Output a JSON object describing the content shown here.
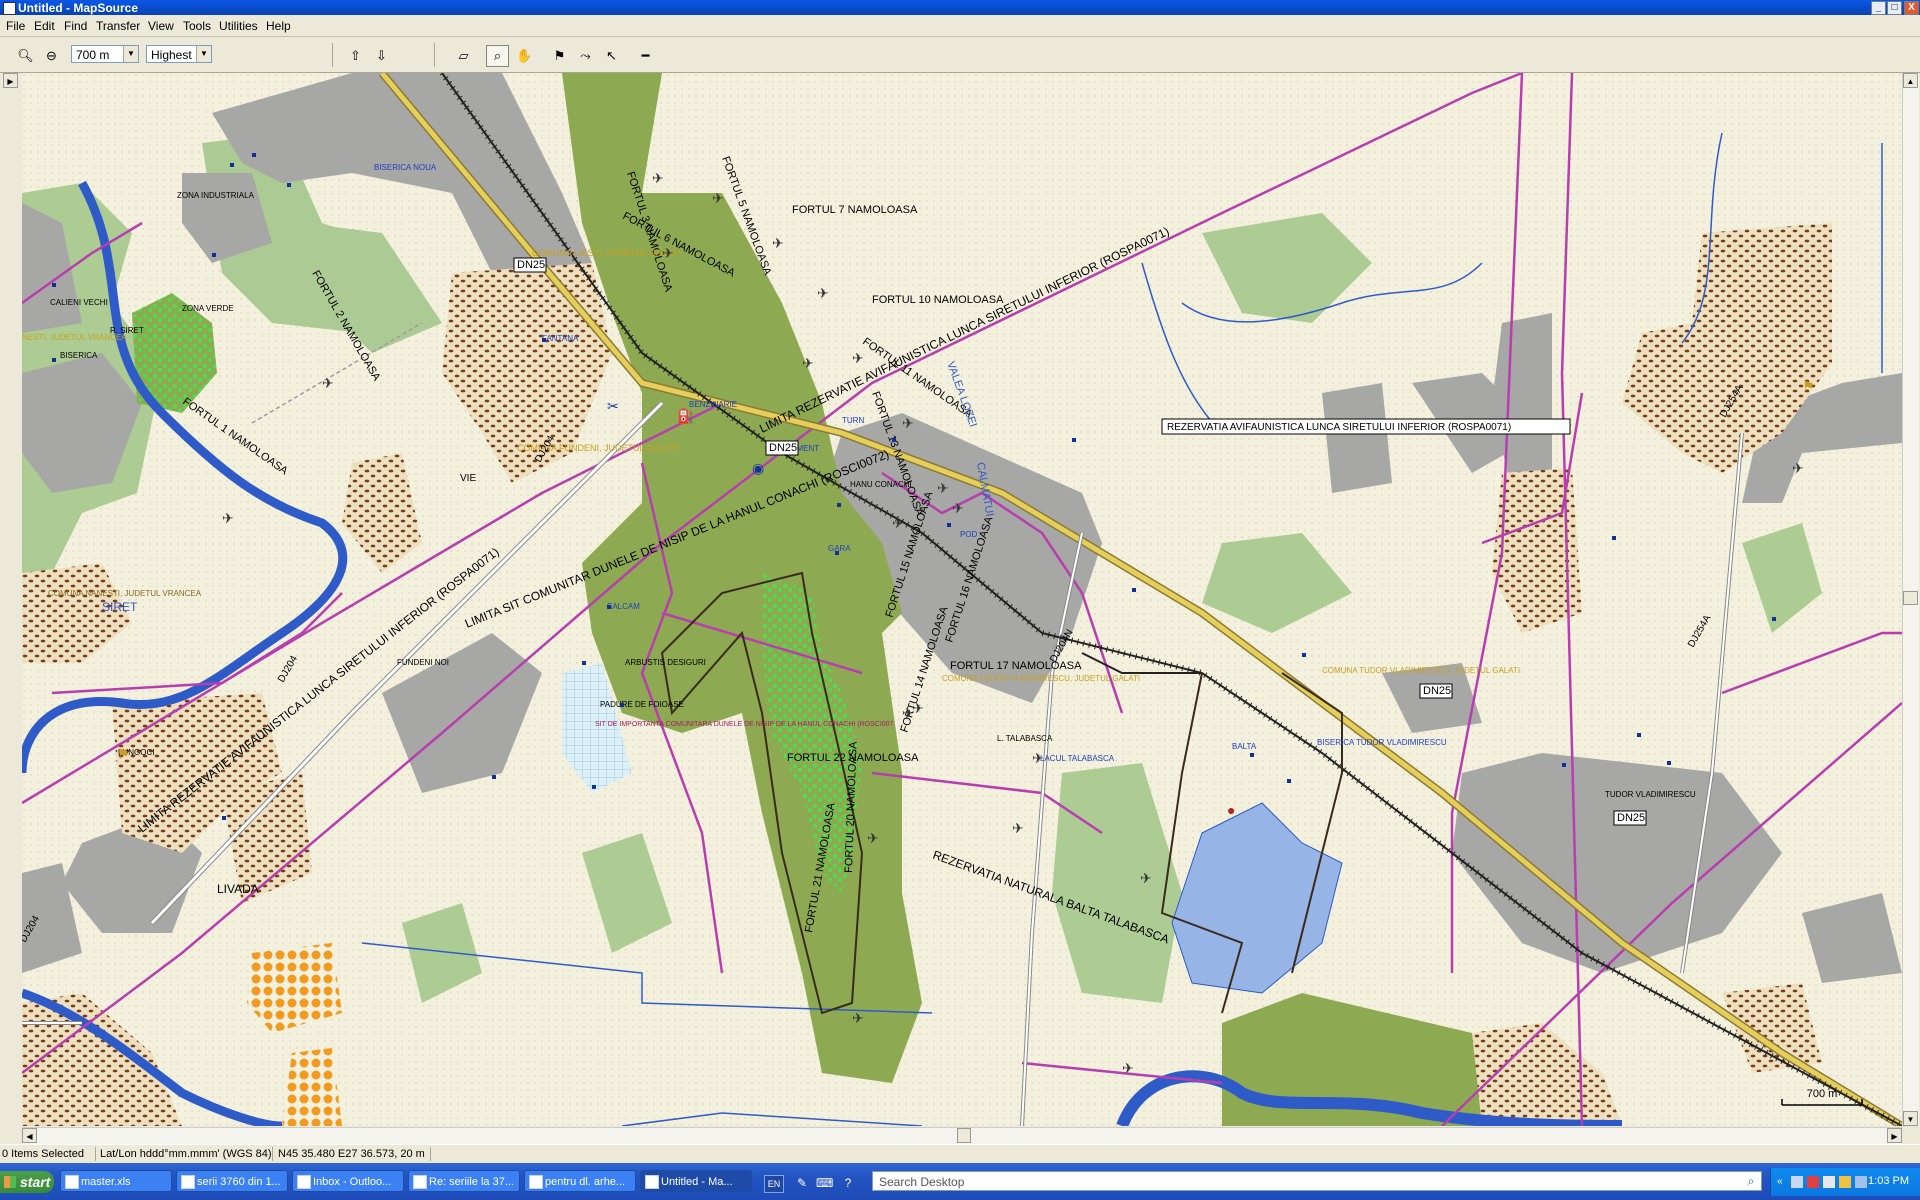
{
  "window": {
    "title": "Untitled - MapSource",
    "buttons": [
      "_",
      "□",
      "X"
    ]
  },
  "menu": [
    "File",
    "Edit",
    "Find",
    "Transfer",
    "View",
    "Tools",
    "Utilities",
    "Help"
  ],
  "toolbar": {
    "zoom_in_icon": "magnifier-plus-icon",
    "zoom_out_icon": "magnifier-minus-icon",
    "zoom_level": "700 m",
    "detail_level": "Highest",
    "tools": [
      "receive-from-device-icon",
      "send-to-device-icon",
      "map-select-icon",
      "zoom-tool-icon",
      "hand-pan-icon",
      "waypoint-tool-icon",
      "route-tool-icon",
      "selection-tool-icon",
      "distance-bearing-icon"
    ]
  },
  "map": {
    "scale_label": "700 m",
    "tooltip": "REZERVATIA AVIFAUNISTICA LUNCA SIRETULUI INFERIOR (ROSPA0071)",
    "colors": {
      "background": "#F4F0DE",
      "forest": "#8DAA52",
      "park": "#9CC386",
      "urban": "#A7A7A5",
      "river": "#2E5BC8",
      "major_road": "#E6CF58",
      "boundary": "#B83EB0"
    },
    "road_labels": [
      {
        "text": "DN25"
      },
      {
        "text": "DN25"
      },
      {
        "text": "DN25"
      },
      {
        "text": "DN25"
      },
      {
        "text": "DJ204"
      },
      {
        "text": "DJ204"
      },
      {
        "text": "DJ204"
      },
      {
        "text": "DJ204N"
      },
      {
        "text": "DJ254A"
      },
      {
        "text": "DJ254A"
      }
    ],
    "labels": [
      {
        "text": "FORTUL 3 NAMOLOASA"
      },
      {
        "text": "FORTUL 5 NAMOLOASA"
      },
      {
        "text": "FORTUL 6 NAMOLOASA"
      },
      {
        "text": "FORTUL 7 NAMOLOASA"
      },
      {
        "text": "FORTUL 10 NAMOLOASA"
      },
      {
        "text": "FORTUL 11 NAMOLOASA"
      },
      {
        "text": "FORTUL 13 NAMOLOASA"
      },
      {
        "text": "FORTUL 2 NAMOLOASA"
      },
      {
        "text": "FORTUL 1 NAMOLOASA"
      },
      {
        "text": "FORTUL 17 NAMOLOASA"
      },
      {
        "text": "FORTUL 22 NAMOLOASA"
      },
      {
        "text": "FORTUL 15 NAMOLOASA"
      },
      {
        "text": "FORTUL 16 NAMOLOASA"
      },
      {
        "text": "FORTUL 20 NAMOLOASA"
      },
      {
        "text": "FORTUL 21 NAMOLOASA"
      },
      {
        "text": "FORTUL 14 NAMOLOASA"
      },
      {
        "text": "COMUNA LIESTI, JUDETUL GALATI"
      },
      {
        "text": "COMUNA FUNDENI, JUDETUL GALATI"
      },
      {
        "text": "COMUNA NANESTI, JUDETUL VRANCEA"
      },
      {
        "text": "COMUNA TUDOR VLADIMIRESCU, JUDETUL GALATI"
      },
      {
        "text": "COMUNA TUDOR VLADIMIRESCU, JUDETUL GALATI"
      },
      {
        "text": "LIMITA REZERVATIE AVIFAUNISTICA LUNCA SIRETULUI INFERIOR (ROSPA0071)"
      },
      {
        "text": "LIMITA SIT COMUNITAR DUNELE DE NISIP DE LA HANUL CONACHI (ROSCI0072)"
      },
      {
        "text": "SIT DE IMPORTANTA COMUNITARA DUNELE DE NISIP DE LA HANUL CONACHI (ROSCI007"
      },
      {
        "text": "REZERVATIA NATURALA BALTA TALABASCA"
      },
      {
        "text": "VALEA LOZEI"
      },
      {
        "text": "CALMATUI"
      },
      {
        "text": "SIRET"
      },
      {
        "text": "ZONA INDUSTRIALA"
      },
      {
        "text": "ZONA VERDE"
      },
      {
        "text": "BISERICA"
      },
      {
        "text": "BISERICA NOUA"
      },
      {
        "text": "BENZINARIE"
      },
      {
        "text": "MONUMENT"
      },
      {
        "text": "TURN"
      },
      {
        "text": "GARA"
      },
      {
        "text": "HANU CONACHI"
      },
      {
        "text": "FANTANA"
      },
      {
        "text": "SALCAM"
      },
      {
        "text": "ARBUSTIS DESIGURI"
      },
      {
        "text": "PADURE DE FOIOASE"
      },
      {
        "text": "LUNGOCI"
      },
      {
        "text": "LIVADA"
      },
      {
        "text": "VIE"
      },
      {
        "text": "FUNDENI NOI"
      },
      {
        "text": "CALIENI VECHI"
      },
      {
        "text": "L. TALABASCA"
      },
      {
        "text": "LACUL TALABASCA"
      },
      {
        "text": "BALTA"
      },
      {
        "text": "TUDOR VLADIMIRESCU"
      },
      {
        "text": "BISERICA TUDOR VLADIMIRESCU"
      },
      {
        "text": "POD"
      },
      {
        "text": "R. SIRET"
      },
      {
        "text": "NESTI, JUDETUL VRANCEA"
      }
    ]
  },
  "status": {
    "selection": "0 Items Selected",
    "format": "Lat/Lon hddd°mm.mmm' (WGS 84)",
    "position": "N45 35.480 E27 36.573, 20 m"
  },
  "taskbar": {
    "start_label": "start",
    "tasks": [
      "master.xls",
      "serii 3760 din 1...",
      "Inbox - Outloo...",
      "Re: seriile la 37...",
      "pentru dl. arhe...",
      "Untitled - Ma..."
    ],
    "language": "EN",
    "search_placeholder": "Search Desktop",
    "clock": "1:03 PM"
  }
}
